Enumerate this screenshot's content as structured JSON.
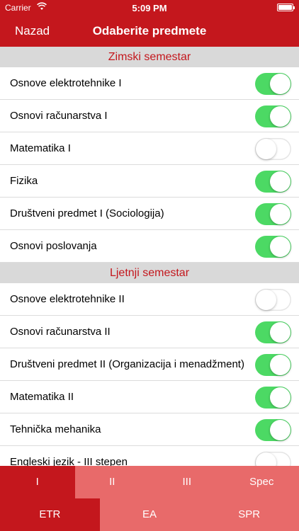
{
  "status_bar": {
    "carrier": "Carrier",
    "time": "5:09 PM"
  },
  "nav": {
    "back_label": "Nazad",
    "title": "Odaberite predmete"
  },
  "sections": [
    {
      "title": "Zimski semestar",
      "items": [
        {
          "label": "Osnove elektrotehnike I",
          "on": true
        },
        {
          "label": "Osnovi računarstva I",
          "on": true
        },
        {
          "label": "Matematika I",
          "on": false
        },
        {
          "label": "Fizika",
          "on": true
        },
        {
          "label": "Društveni predmet I (Sociologija)",
          "on": true
        },
        {
          "label": "Osnovi poslovanja",
          "on": true
        }
      ]
    },
    {
      "title": "Ljetnji semestar",
      "items": [
        {
          "label": "Osnove elektrotehnike II",
          "on": false
        },
        {
          "label": "Osnovi računarstva II",
          "on": true
        },
        {
          "label": "Društveni predmet II (Organizacija i menadžment)",
          "on": true
        },
        {
          "label": "Matematika II",
          "on": true
        },
        {
          "label": "Tehnička mehanika",
          "on": true
        },
        {
          "label": "Engleski jezik - III stepen",
          "on": false
        }
      ]
    }
  ],
  "year_tabs": {
    "items": [
      "I",
      "II",
      "III",
      "Spec"
    ],
    "selected": "I"
  },
  "dept_tabs": {
    "items": [
      "ETR",
      "EA",
      "SPR"
    ],
    "selected": "ETR"
  },
  "colors": {
    "primary": "#c4171d",
    "tab_inactive": "#e86a6a",
    "switch_on": "#4cd964",
    "section_bg": "#d9d9d9"
  },
  "icons": {
    "wifi": "wifi-icon",
    "battery": "battery-icon"
  }
}
